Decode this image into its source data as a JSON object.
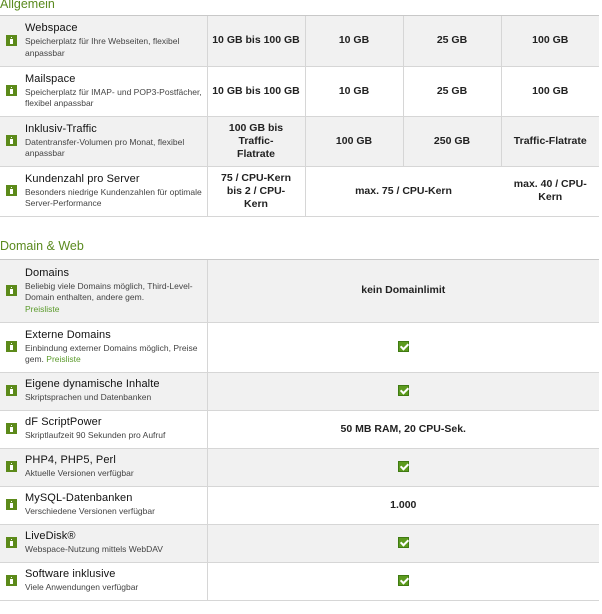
{
  "sections": {
    "allgemein": {
      "title": "Allgemein"
    },
    "domain_web": {
      "title": "Domain & Web"
    }
  },
  "allgemein_rows": [
    {
      "title": "Webspace",
      "desc": "Speicherplatz für Ihre Webseiten, flexibel anpassbar",
      "values": [
        "10 GB bis 100 GB",
        "10 GB",
        "25 GB",
        "100 GB"
      ]
    },
    {
      "title": "Mailspace",
      "desc": "Speicherplatz für IMAP- und POP3-Postfächer, flexibel anpassbar",
      "values": [
        "10 GB bis 100 GB",
        "10 GB",
        "25 GB",
        "100 GB"
      ]
    },
    {
      "title": "Inklusiv-Traffic",
      "desc": "Datentransfer-Volumen pro Monat, flexibel anpassbar",
      "values": [
        "100 GB bis Traffic-Flatrate",
        "100 GB",
        "250 GB",
        "Traffic-Flatrate"
      ]
    },
    {
      "title": "Kundenzahl pro Server",
      "desc": "Besonders niedrige Kundenzahlen für optimale Server-Performance",
      "values": [
        "75 / CPU-Kern bis 2 / CPU-Kern",
        "max. 75 / CPU-Kern",
        "max. 40 / CPU-Kern"
      ]
    }
  ],
  "domain_rows": [
    {
      "title": "Domains",
      "desc": "Beliebig viele Domains möglich, Third-Level-Domain enthalten, andere gem.",
      "link": "Preisliste",
      "value": "kein Domainlimit"
    },
    {
      "title": "Externe Domains",
      "desc": "Einbindung externer Domains möglich, Preise gem.",
      "link": "Preisliste",
      "check": true
    },
    {
      "title": "Eigene dynamische Inhalte",
      "desc": "Skriptsprachen und Datenbanken",
      "check": true
    },
    {
      "title": "dF ScriptPower",
      "desc": "Skriptlaufzeit 90 Sekunden pro Aufruf",
      "value": "50 MB RAM, 20 CPU-Sek."
    },
    {
      "title": "PHP4, PHP5, Perl",
      "desc": "Aktuelle Versionen verfügbar",
      "check": true
    },
    {
      "title": "MySQL-Datenbanken",
      "desc": "Verschiedene Versionen verfügbar",
      "value": "1.000"
    },
    {
      "title": "LiveDisk®",
      "desc": "Webspace-Nutzung mittels WebDAV",
      "check": true
    },
    {
      "title": "Software inklusive",
      "desc": "Viele Anwendungen verfügbar",
      "check": true
    }
  ],
  "icons": {
    "info": "info-icon",
    "check": "check-icon"
  },
  "colors": {
    "accent": "#5a8a1e",
    "row_alt": "#f1f1f1",
    "border": "#d6d6d6"
  }
}
